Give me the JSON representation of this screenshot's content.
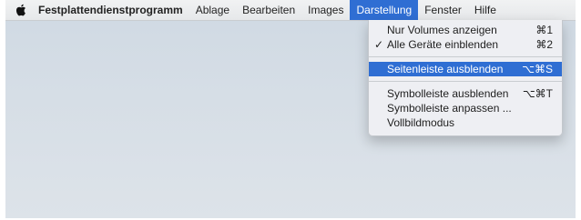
{
  "menubar": {
    "app_name": "Festplattendienstprogramm",
    "items": [
      "Ablage",
      "Bearbeiten",
      "Images",
      "Darstellung",
      "Fenster",
      "Hilfe"
    ],
    "active_item": "Darstellung"
  },
  "dropdown": {
    "items": [
      {
        "label": "Nur Volumes anzeigen",
        "shortcut": "⌘1",
        "checked": false
      },
      {
        "label": "Alle Geräte einblenden",
        "shortcut": "⌘2",
        "checked": true,
        "check_mark": "✓"
      },
      {
        "label": "Seitenleiste ausblenden",
        "shortcut": "⌥⌘S",
        "highlighted": true
      },
      {
        "label": "Symbolleiste ausblenden",
        "shortcut": "⌥⌘T"
      },
      {
        "label": "Symbolleiste anpassen ...",
        "shortcut": ""
      },
      {
        "label": "Vollbildmodus",
        "shortcut": ""
      }
    ]
  },
  "colors": {
    "accent": "#2f6ed3",
    "menubar_bg": "#ebecee",
    "desktop": "#d4dde6"
  },
  "icons": {
    "apple": "apple-logo-icon"
  }
}
